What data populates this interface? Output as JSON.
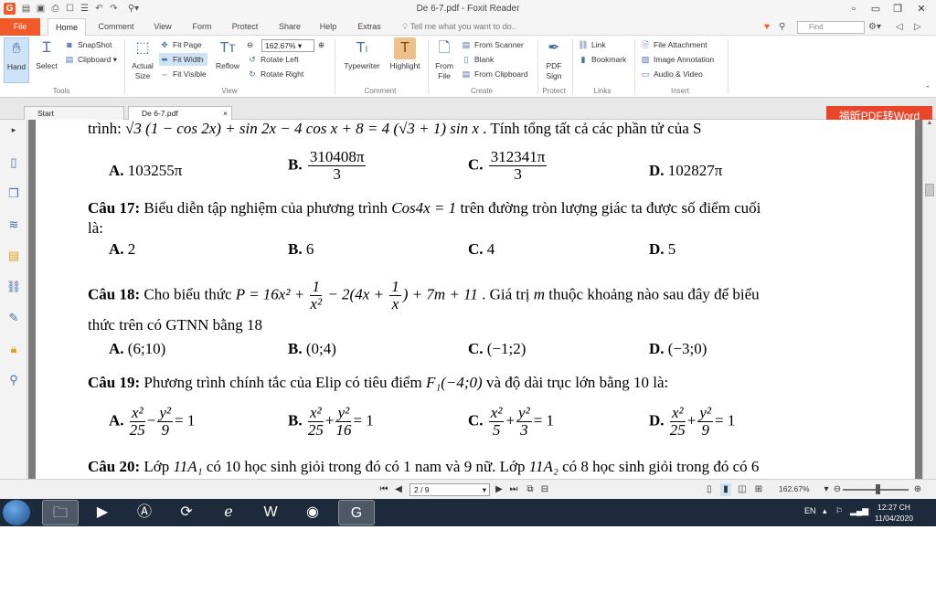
{
  "window": {
    "title": "De 6-7.pdf - Foxit Reader",
    "logo": "G"
  },
  "menu": {
    "file": "File",
    "tabs": [
      "Home",
      "Comment",
      "View",
      "Form",
      "Protect",
      "Share",
      "Help",
      "Extras"
    ],
    "tell_me": "Tell me what you want to do..",
    "find_placeholder": "Find"
  },
  "ribbon": {
    "tools": {
      "hand": "Hand",
      "select": "Select",
      "snapshot": "SnapShot",
      "clipboard": "Clipboard",
      "group": "Tools"
    },
    "view": {
      "actual_size_1": "Actual",
      "actual_size_2": "Size",
      "fit_page": "Fit Page",
      "fit_width": "Fit Width",
      "fit_visible": "Fit Visible",
      "reflow": "Reflow",
      "zoom": "162.67%",
      "rotate_left": "Rotate Left",
      "rotate_right": "Rotate Right",
      "group": "View"
    },
    "comment": {
      "typewriter": "Typewriter",
      "highlight": "Highlight",
      "group": "Comment"
    },
    "create": {
      "from_file_1": "From",
      "from_file_2": "File",
      "from_scanner": "From Scanner",
      "blank": "Blank",
      "from_clipboard": "From Clipboard",
      "group": "Create"
    },
    "protect": {
      "pdf_sign_1": "PDF",
      "pdf_sign_2": "Sign",
      "group": "Protect"
    },
    "links": {
      "link": "Link",
      "bookmark": "Bookmark",
      "group": "Links"
    },
    "insert": {
      "file_attachment": "File Attachment",
      "image_annotation": "Image Annotation",
      "audio_video": "Audio & Video",
      "group": "Insert"
    }
  },
  "doc_tabs": {
    "start": "Start",
    "current": "De 6-7.pdf",
    "pdf_to_word": "福昕PDF转Word"
  },
  "document": {
    "line_top": {
      "a": "trình: ",
      "b": ". Tính tổng tất cả các phần tử của S"
    },
    "q16_answers": {
      "a_label": "A.",
      "a_val": "103255π",
      "b_label": "B.",
      "b_num": "310408π",
      "b_den": "3",
      "c_label": "C.",
      "c_num": "312341π",
      "c_den": "3",
      "d_label": "D.",
      "d_val": "102827π"
    },
    "q17": {
      "label": "Câu 17:",
      "text_a": " Biểu diễn tập nghiệm của phương trình ",
      "eq": "Cos4x = 1",
      "text_b": " trên đường tròn lượng giác ta được số điểm cuối",
      "text_c": "là:",
      "a_label": "A.",
      "a_val": "2",
      "b_label": "B.",
      "b_val": "6",
      "c_label": "C.",
      "c_val": "4",
      "d_label": "D.",
      "d_val": "5"
    },
    "q18": {
      "label": "Câu 18:",
      "text_a": " Cho biểu thức ",
      "text_b": ". Giá trị ",
      "var": "m",
      "text_c": " thuộc khoảng nào sau đây để biểu",
      "text_d": "thức  trên có GTNN bằng 18",
      "a_label": "A.",
      "a_val": "(6;10)",
      "b_label": "B.",
      "b_val": "(0;4)",
      "c_label": "C.",
      "c_val": "(−1;2)",
      "d_label": "D.",
      "d_val": "(−3;0)"
    },
    "q19": {
      "label": "Câu 19:",
      "text_a": " Phương trình chính tắc của Elip có tiêu điểm ",
      "focus": "F₁(−4;0)",
      "text_b": " và độ dài trục lớn bằng 10 là:",
      "a_label": "A.",
      "b_label": "B.",
      "c_label": "C.",
      "d_label": "D."
    },
    "q20": {
      "label": "Câu 20:",
      "text_a": " Lớp ",
      "class1": "11A₁",
      "text_b": " có 10 học sinh giỏi trong đó có 1 nam và 9 nữ. Lớp ",
      "class2": "11A₂",
      "text_c": " có 8 học sinh giỏi trong đó có 6"
    }
  },
  "statusbar": {
    "page": "2 / 9",
    "zoom": "162.67%"
  },
  "taskbar": {
    "lang": "EN",
    "time": "12:27 CH",
    "date": "11/04/2020"
  },
  "colors": {
    "accent": "#f05a28",
    "ribbon_blue": "#4a6fa5",
    "taskbar": "#1d2a3c"
  }
}
